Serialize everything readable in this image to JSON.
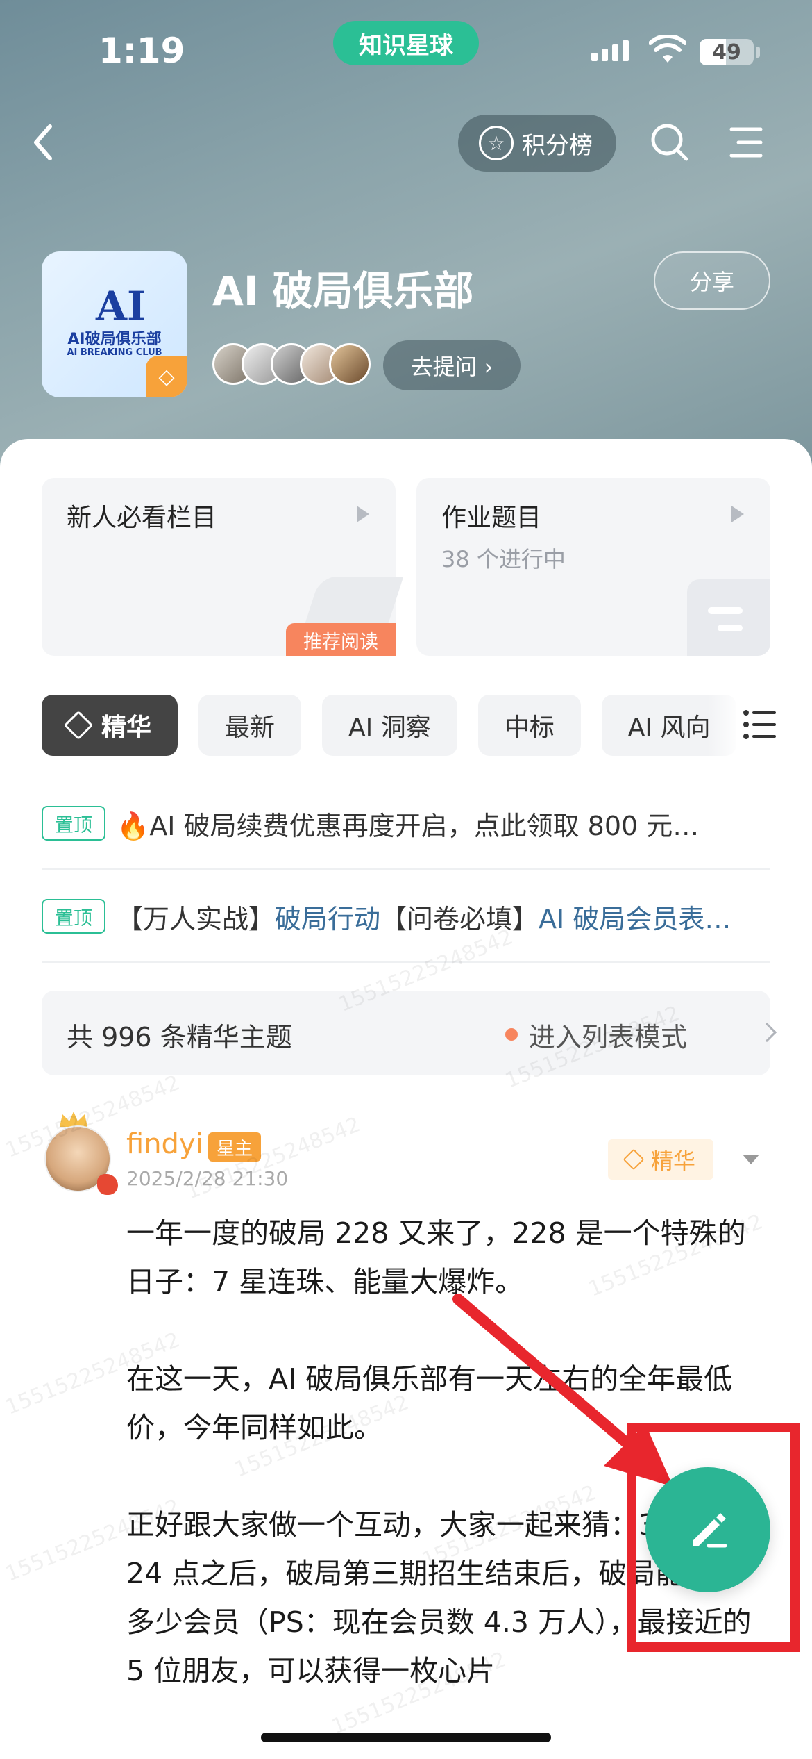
{
  "status_bar": {
    "time": "1:19",
    "app_pill": "知识星球",
    "battery": "49",
    "battery_level": 0.49
  },
  "nav": {
    "rank_label": "积分榜"
  },
  "club": {
    "title": "AI 破局俱乐部",
    "share_label": "分享",
    "ask_label": "去提问 ›",
    "logo_text": "AI破局俱乐部",
    "logo_sub": "AI BREAKING CLUB"
  },
  "cards": [
    {
      "title": "新人必看栏目",
      "tag": "推荐阅读"
    },
    {
      "title": "作业题目",
      "subtitle": "38 个进行中"
    }
  ],
  "tabs": [
    "精华",
    "最新",
    "AI 洞察",
    "中标",
    "AI 风向"
  ],
  "pinned": [
    {
      "badge": "置顶",
      "text": "🔥AI 破局续费优惠再度开启，点此领取 800 元…"
    },
    {
      "badge": "置顶",
      "prefix1": "【万人实战】",
      "link1": "破局行动",
      "prefix2": "【问卷必填】",
      "link2": "AI 破局会员表…"
    }
  ],
  "summary": {
    "count": "共 996 条精华主题",
    "mode": "进入列表模式"
  },
  "post": {
    "author": "findyi",
    "role_tag": "星主",
    "time": "2025/2/28 21:30",
    "essence_tag": "精华",
    "paragraphs": [
      "一年一度的破局 228 又来了，228 是一个特殊的日子：7 星连珠、能量大爆炸。",
      "在这一天，AI 破局俱乐部有一天左右的全年最低价，今年同样如此。",
      "正好跟大家做一个互动，大家一起来猜：3月3日 24 点之后，破局第三期招生结束后，破局能做到多少会员（PS：现在会员数 4.3 万人），最接近的 5 位朋友，可以获得一枚心片"
    ]
  },
  "watermark": "15515225248542",
  "colors": {
    "brand_green": "#2bbf95",
    "orange": "#f7a23a",
    "annotation_red": "#e8262d"
  }
}
